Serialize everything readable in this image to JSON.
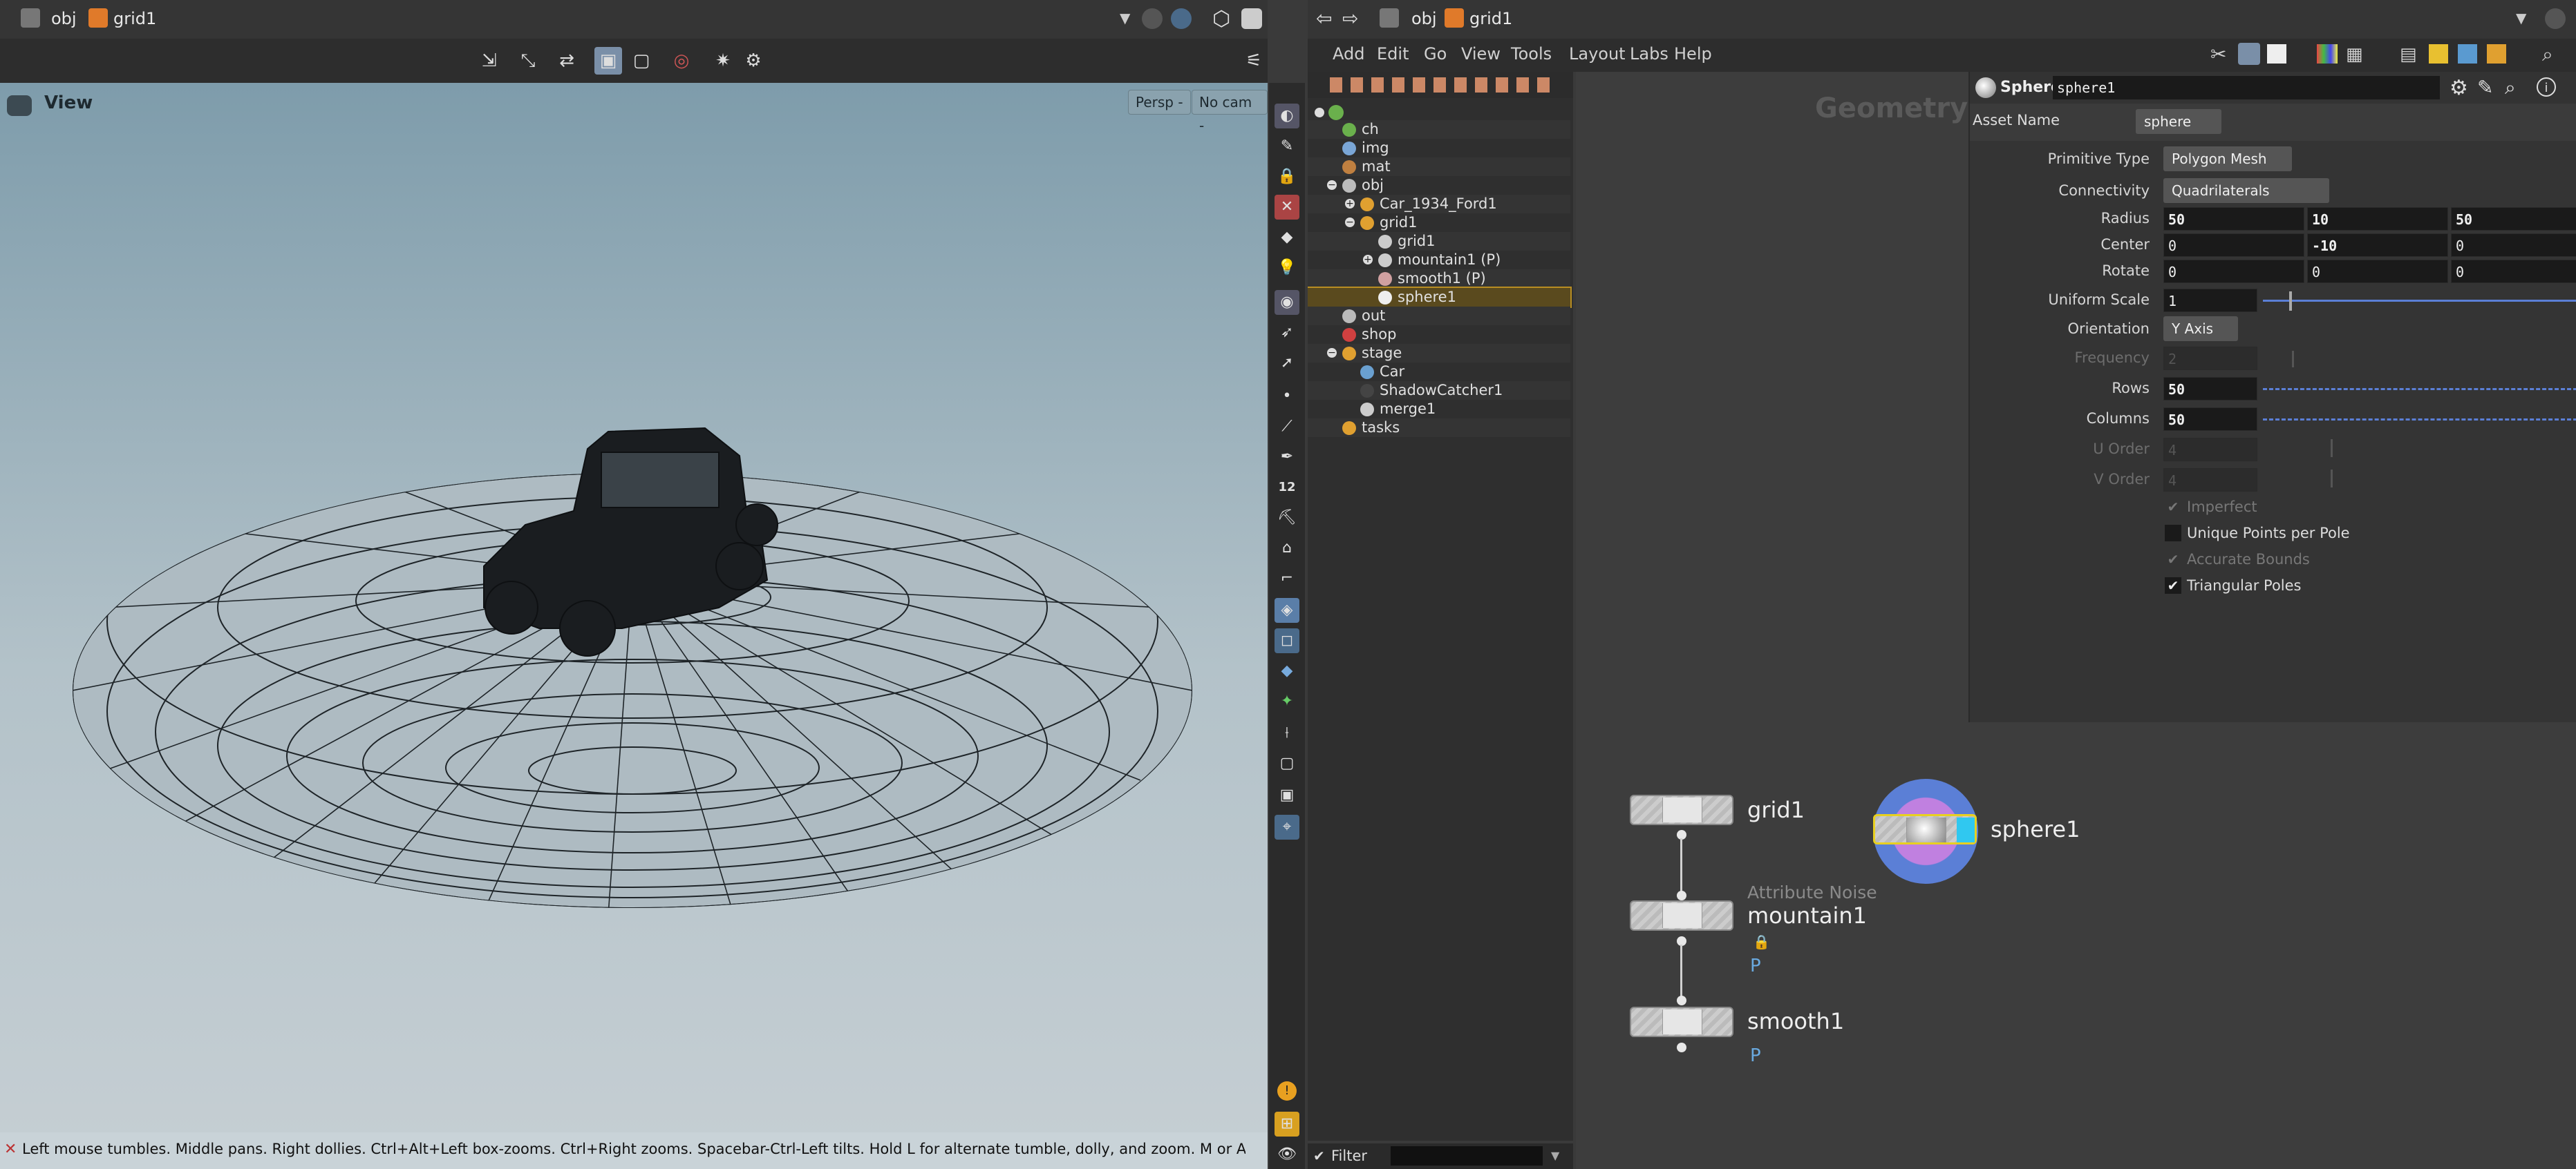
{
  "left_pane": {
    "path": {
      "root": "obj",
      "node": "grid1"
    },
    "viewport": {
      "title": "View",
      "persp_label": "Persp -",
      "cam_label": "No cam -",
      "status_message": "Left mouse tumbles. Middle pans. Right dollies. Ctrl+Alt+Left box-zooms. Ctrl+Right zooms. Spacebar-Ctrl-Left tilts. Hold L for alternate tumble, dolly, and zoom. M or Alt+M for First Person Navigation."
    },
    "shelf_badge": "12"
  },
  "right_pane": {
    "path": {
      "root": "obj",
      "node": "grid1"
    },
    "menu": [
      "Add",
      "Edit",
      "Go",
      "View",
      "Tools",
      "Layout",
      "Labs",
      "Help"
    ],
    "tree": [
      {
        "label": "ch",
        "indent": 0,
        "color": "#6ab04c"
      },
      {
        "label": "img",
        "indent": 0,
        "color": "#7aa6d6"
      },
      {
        "label": "mat",
        "indent": 0,
        "color": "#c08040"
      },
      {
        "label": "obj",
        "indent": 0,
        "color": "#bbbbbb"
      },
      {
        "label": "Car_1934_Ford1",
        "indent": 1,
        "color": "#e0a030"
      },
      {
        "label": "grid1",
        "indent": 1,
        "color": "#e0a030"
      },
      {
        "label": "grid1",
        "indent": 2,
        "color": "#cccccc"
      },
      {
        "label": "mountain1 (P)",
        "indent": 2,
        "color": "#cccccc"
      },
      {
        "label": "smooth1 (P)",
        "indent": 2,
        "color": "#d0a0a0"
      },
      {
        "label": "sphere1",
        "indent": 2,
        "color": "#eeeeee",
        "selected": true
      },
      {
        "label": "out",
        "indent": 0,
        "color": "#bbbbbb"
      },
      {
        "label": "shop",
        "indent": 0,
        "color": "#d04040"
      },
      {
        "label": "stage",
        "indent": 0,
        "color": "#e0a030"
      },
      {
        "label": "Car",
        "indent": 1,
        "color": "#6aa0d0"
      },
      {
        "label": "ShadowCatcher1",
        "indent": 1,
        "color": "#444444"
      },
      {
        "label": "merge1",
        "indent": 1,
        "color": "#cccccc"
      },
      {
        "label": "tasks",
        "indent": 0,
        "color": "#e0a030"
      }
    ],
    "network_title": "Geometry",
    "filter_label": "Filter",
    "params": {
      "node_type": "Sphere",
      "node_name": "sphere1",
      "asset_name_label": "Asset Name",
      "asset_name_value": "sphere",
      "primitive_type_label": "Primitive Type",
      "primitive_type_value": "Polygon Mesh",
      "connectivity_label": "Connectivity",
      "connectivity_value": "Quadrilaterals",
      "radius_label": "Radius",
      "radius": [
        "50",
        "10",
        "50"
      ],
      "center_label": "Center",
      "center": [
        "0",
        "-10",
        "0"
      ],
      "rotate_label": "Rotate",
      "rotate": [
        "0",
        "0",
        "0"
      ],
      "uniform_scale_label": "Uniform Scale",
      "uniform_scale": "1",
      "orientation_label": "Orientation",
      "orientation_value": "Y Axis",
      "frequency_label": "Frequency",
      "frequency": "2",
      "rows_label": "Rows",
      "rows": "50",
      "columns_label": "Columns",
      "columns": "50",
      "u_order_label": "U Order",
      "u_order": "4",
      "v_order_label": "V Order",
      "v_order": "4",
      "imperfect_label": "Imperfect",
      "unique_points_label": "Unique Points per Pole",
      "accurate_bounds_label": "Accurate Bounds",
      "triangular_poles_label": "Triangular Poles"
    },
    "nodes": {
      "grid": "grid1",
      "mountain_type": "Attribute Noise",
      "mountain": "mountain1",
      "mountain_flag": "P",
      "smooth": "smooth1",
      "smooth_flag": "P",
      "sphere": "sphere1"
    }
  },
  "colors": {
    "accent": "#7a8fa8",
    "selection": "#b88d22",
    "sphere_ring": "#5b7fd6"
  }
}
